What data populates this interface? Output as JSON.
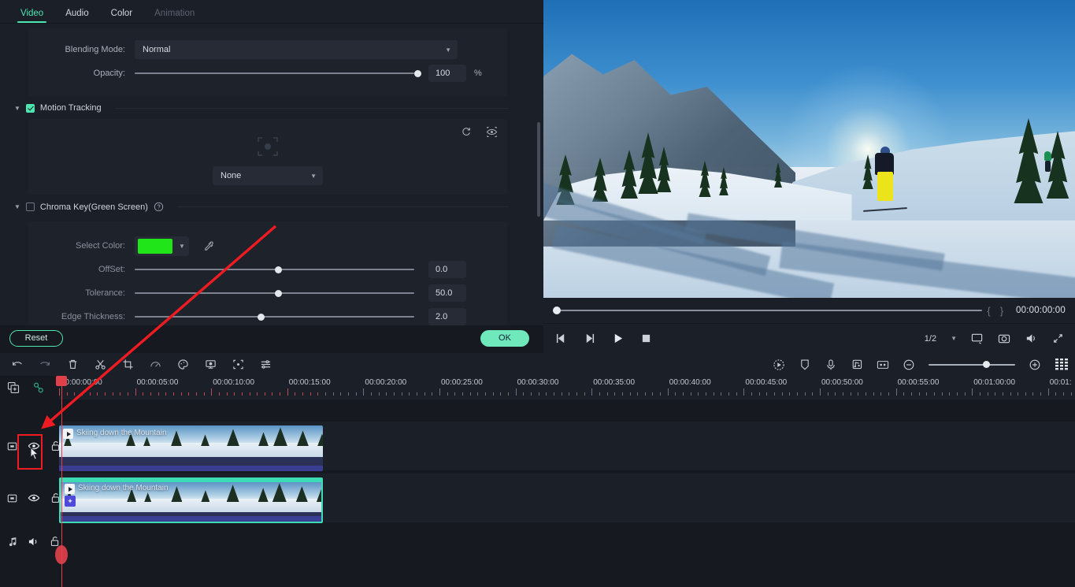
{
  "tabs": [
    {
      "label": "Video",
      "state": "active"
    },
    {
      "label": "Audio",
      "state": "normal"
    },
    {
      "label": "Color",
      "state": "normal"
    },
    {
      "label": "Animation",
      "state": "disabled"
    }
  ],
  "properties": {
    "blending": {
      "label": "Blending Mode:",
      "value": "Normal"
    },
    "opacity": {
      "label": "Opacity:",
      "value": "100",
      "unit": "%",
      "percent": 100
    },
    "motion_tracking": {
      "label": "Motion Tracking",
      "checked": true,
      "target_preset": "None",
      "reset_icon": "reset-icon",
      "preview_icon": "eye-target-icon"
    },
    "chroma_key": {
      "label": "Chroma Key(Green Screen)",
      "checked": false,
      "help_icon": "help-icon",
      "select_color": {
        "label": "Select Color:",
        "color": "#1fe519",
        "picker_icon": "eyedropper-icon"
      },
      "offset": {
        "label": "OffSet:",
        "value": "0.0",
        "percent": 50
      },
      "tolerance": {
        "label": "Tolerance:",
        "value": "50.0",
        "percent": 50
      },
      "edge_thickness": {
        "label": "Edge Thickness:",
        "value": "2.0",
        "percent": 44
      }
    }
  },
  "panel_actions": {
    "reset": "Reset",
    "ok": "OK"
  },
  "player": {
    "timecode": "00:00:00:00",
    "mark_in": "{",
    "mark_out": "}",
    "quality": "1/2",
    "controls": [
      {
        "name": "previous-frame-icon"
      },
      {
        "name": "next-frame-icon"
      },
      {
        "name": "play-icon"
      },
      {
        "name": "stop-icon"
      }
    ],
    "right_controls": [
      {
        "name": "monitor-icon"
      },
      {
        "name": "snapshot-icon"
      },
      {
        "name": "volume-icon"
      },
      {
        "name": "fullscreen-icon"
      }
    ]
  },
  "timeline_toolbar": {
    "left_icons": [
      {
        "name": "undo-icon"
      },
      {
        "name": "redo-icon"
      },
      {
        "name": "delete-icon"
      },
      {
        "name": "split-icon"
      },
      {
        "name": "crop-icon"
      },
      {
        "name": "speed-icon"
      },
      {
        "name": "color-icon"
      },
      {
        "name": "green-screen-icon"
      },
      {
        "name": "detect-icon"
      },
      {
        "name": "adjust-icon"
      }
    ],
    "right_icons": [
      {
        "name": "record-icon"
      },
      {
        "name": "marker-icon"
      },
      {
        "name": "microphone-icon"
      },
      {
        "name": "voiceover-icon"
      },
      {
        "name": "split-view-icon"
      }
    ],
    "zoom_out": "−",
    "zoom_in": "+",
    "zoom_percent": 63,
    "grid_icon": "grid-icon",
    "sub_icons": [
      {
        "name": "duplicate-icon"
      },
      {
        "name": "link-icon"
      }
    ]
  },
  "ruler": {
    "labels": [
      "00:00:00:00",
      "00:00:05:00",
      "00:00:10:00",
      "00:00:15:00",
      "00:00:20:00",
      "00:00:25:00",
      "00:00:30:00",
      "00:00:35:00",
      "00:00:40:00",
      "00:00:45:00",
      "00:00:50:00",
      "00:00:55:00",
      "00:01:00:00",
      "00:01:"
    ]
  },
  "tracks": [
    {
      "name": "video-track-1",
      "icons": [
        "track-type-icon",
        "eye-icon",
        "unlock-icon"
      ],
      "highlighted_icon": "eye-icon",
      "clip": {
        "title": "Skiing down the Mountain",
        "selected": false
      }
    },
    {
      "name": "video-track-2",
      "icons": [
        "track-type-icon",
        "eye-icon",
        "unlock-icon"
      ],
      "clip": {
        "title": "Skiing down the Mountain",
        "selected": true,
        "fx_badge": "effect-icon"
      }
    },
    {
      "name": "audio-track-1",
      "icons": [
        "music-note-icon",
        "speaker-icon",
        "unlock-icon"
      ]
    }
  ],
  "annotation": {
    "arrow": "red-arrow",
    "highlight": "red-highlight-box",
    "cursor": "mouse-cursor"
  },
  "colors": {
    "accent": "#4ee6b0",
    "annotation": "#ee1c22",
    "playhead": "#e0404a",
    "panel_bg": "#1b1f27",
    "app_bg": "#16191f",
    "chroma_green": "#1fe519"
  }
}
